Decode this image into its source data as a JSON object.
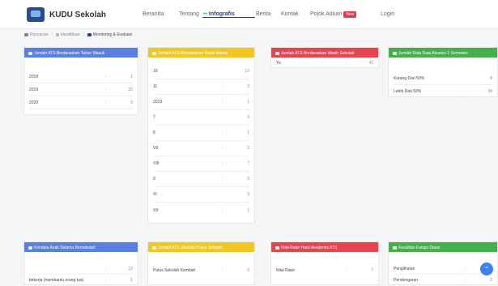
{
  "app": {
    "logo_text": "KUDU Sekolah"
  },
  "nav": {
    "items": [
      {
        "label": "Beranda"
      },
      {
        "label": "Tentang"
      },
      {
        "label": "Infografis",
        "active_prefix": "••"
      },
      {
        "label": "Berita"
      },
      {
        "label": "Kontak"
      },
      {
        "label": "Pojok Aduan",
        "badge": "New"
      },
      {
        "label": "Login"
      }
    ]
  },
  "subnav": {
    "items": [
      {
        "label": "Pencarian"
      },
      {
        "label": "Identifikasi"
      },
      {
        "label": "Monitoring & Evaluasi"
      }
    ]
  },
  "colors": {
    "blue": "#5b7fe0",
    "yellow": "#f2c81f",
    "red": "#e8434f",
    "green": "#43b049",
    "nav_active": "#2a3e8c",
    "fab": "#3b82f6"
  },
  "cards": [
    {
      "title": "Jumlah ATS Berdasarkan Tahun Masuk",
      "rows": [
        {
          "label": "2018",
          "sep": ":",
          "value": "1"
        },
        {
          "label": "2019",
          "sep": ":",
          "value": "32"
        },
        {
          "label": "2020",
          "sep": ":",
          "value": "5"
        }
      ]
    },
    {
      "title": "Jumlah ATS Berdasarkan Kelas Masuk",
      "rows": [
        {
          "label": "10",
          "sep": ":",
          "value": "13"
        },
        {
          "label": "11",
          "sep": ":",
          "value": "3"
        },
        {
          "label": "2019",
          "sep": ":",
          "value": "1"
        },
        {
          "label": "7",
          "sep": ":",
          "value": "3"
        },
        {
          "label": "8",
          "sep": ":",
          "value": "1"
        },
        {
          "label": "VII",
          "sep": ":",
          "value": "2"
        },
        {
          "label": "VIII",
          "sep": ":",
          "value": "7"
        },
        {
          "label": "9",
          "sep": ":",
          "value": "3"
        },
        {
          "label": "XI",
          "sep": ":",
          "value": "3"
        },
        {
          "label": "XII",
          "sep": ":",
          "value": "1"
        }
      ]
    },
    {
      "title": "Jumlah ATS Berdasarkan Masih Sekolah",
      "rows": [
        {
          "label": "Ya",
          "sep": ":",
          "value": "42"
        }
      ]
    },
    {
      "title": "Jumlah Rata Rata Absensi 1 Semester",
      "rows": [
        {
          "label": "Kurang Dari 50%",
          "sep": ":",
          "value": "8"
        },
        {
          "label": "Lebih Dari 50%",
          "sep": ":",
          "value": "34"
        }
      ]
    },
    {
      "title": "Kendala Anak Selama Bersekolah",
      "rows": [
        {
          "label": "",
          "sep": ":",
          "value": "13"
        },
        {
          "label": "bekerja (membantu orang tua)",
          "sep": ":",
          "value": "1"
        }
      ]
    },
    {
      "title": "Jumlah ATS Sekolah Putus Sekolah",
      "rows": [
        {
          "label": "Putus Sekolah Kembali",
          "sep": ":",
          "value": "0"
        }
      ]
    },
    {
      "title": "Nilai Rata² Hasil Akademis ATS",
      "rows": [
        {
          "label": "Nilai Rata²",
          "sep": ":",
          "value": "7"
        }
      ]
    },
    {
      "title": "Kesulitan Fungsi Dasar",
      "rows": [
        {
          "label": "Penglihatan",
          "sep": ":",
          "value": ""
        },
        {
          "label": "Pendengaran",
          "sep": ":",
          "value": "0"
        }
      ]
    }
  ],
  "fab": {
    "icon": "chevron-up-icon",
    "glyph": "⌃"
  }
}
